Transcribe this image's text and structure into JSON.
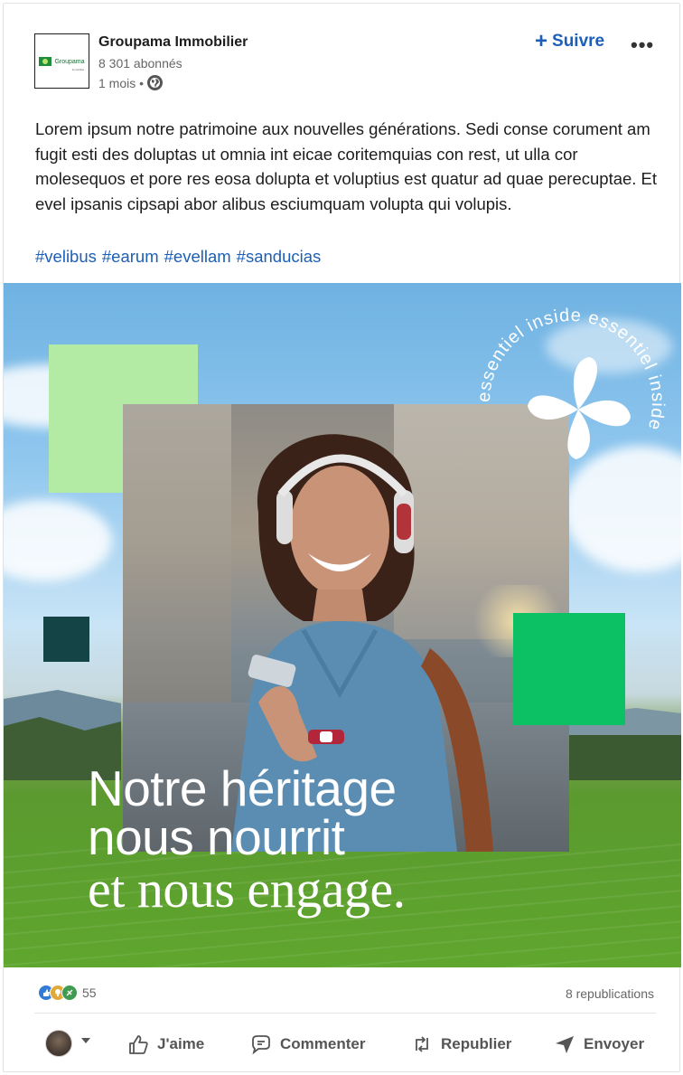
{
  "post": {
    "company_name": "Groupama Immobilier",
    "followers": "8 301 abonnés",
    "age": "1 mois •",
    "follow_label": "Suivre",
    "follow_plus": "+",
    "more_label": "•••",
    "logo_text": "Groupama",
    "logo_sub": "Immobilier",
    "body": "Lorem ipsum notre patrimoine aux nouvelles générations. Sedi conse corument am fugit esti des doluptas ut omnia int eicae coritemquias con rest, ut ulla cor molesequos et pore res eosa dolupta et voluptius est quatur ad quae perecuptae. Et evel ipsanis cipsapi abor alibus esciumquam volupta qui volupis.",
    "hashtags": [
      "#velibus",
      "#earum",
      "#evellam",
      "#sanducias"
    ]
  },
  "image": {
    "headline_line1": "Notre héritage",
    "headline_line2": "nous nourrit",
    "headline_line3": "et nous engage.",
    "badge_text": "essentiel inside essentiel inside"
  },
  "engagement": {
    "reaction_count": "55",
    "reposts": "8 republications"
  },
  "actions": {
    "like": "J'aime",
    "comment": "Commenter",
    "repost": "Republier",
    "send": "Envoyer"
  },
  "colors": {
    "accent_blue": "#1d5fb8",
    "light_green": "#b3eaa4",
    "dark_teal": "#154447",
    "bright_green": "#0cc064"
  }
}
